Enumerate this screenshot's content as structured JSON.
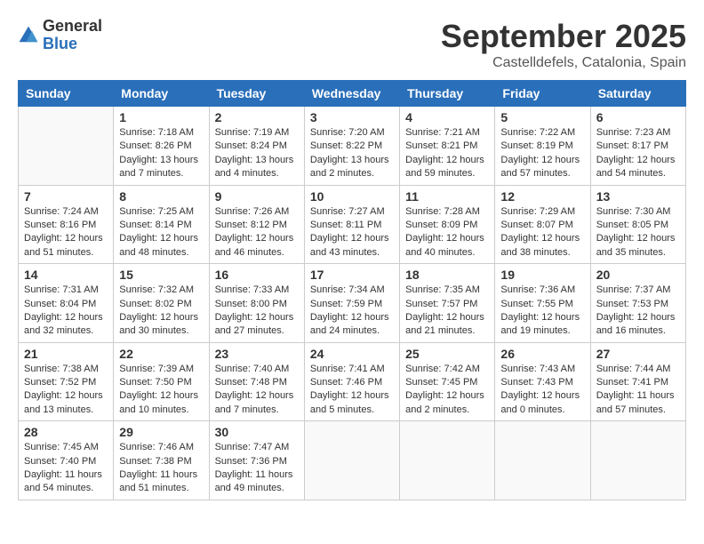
{
  "logo": {
    "general": "General",
    "blue": "Blue"
  },
  "header": {
    "month": "September 2025",
    "location": "Castelldefels, Catalonia, Spain"
  },
  "weekdays": [
    "Sunday",
    "Monday",
    "Tuesday",
    "Wednesday",
    "Thursday",
    "Friday",
    "Saturday"
  ],
  "weeks": [
    [
      {
        "day": "",
        "sunrise": "",
        "sunset": "",
        "daylight": ""
      },
      {
        "day": "1",
        "sunrise": "Sunrise: 7:18 AM",
        "sunset": "Sunset: 8:26 PM",
        "daylight": "Daylight: 13 hours and 7 minutes."
      },
      {
        "day": "2",
        "sunrise": "Sunrise: 7:19 AM",
        "sunset": "Sunset: 8:24 PM",
        "daylight": "Daylight: 13 hours and 4 minutes."
      },
      {
        "day": "3",
        "sunrise": "Sunrise: 7:20 AM",
        "sunset": "Sunset: 8:22 PM",
        "daylight": "Daylight: 13 hours and 2 minutes."
      },
      {
        "day": "4",
        "sunrise": "Sunrise: 7:21 AM",
        "sunset": "Sunset: 8:21 PM",
        "daylight": "Daylight: 12 hours and 59 minutes."
      },
      {
        "day": "5",
        "sunrise": "Sunrise: 7:22 AM",
        "sunset": "Sunset: 8:19 PM",
        "daylight": "Daylight: 12 hours and 57 minutes."
      },
      {
        "day": "6",
        "sunrise": "Sunrise: 7:23 AM",
        "sunset": "Sunset: 8:17 PM",
        "daylight": "Daylight: 12 hours and 54 minutes."
      }
    ],
    [
      {
        "day": "7",
        "sunrise": "Sunrise: 7:24 AM",
        "sunset": "Sunset: 8:16 PM",
        "daylight": "Daylight: 12 hours and 51 minutes."
      },
      {
        "day": "8",
        "sunrise": "Sunrise: 7:25 AM",
        "sunset": "Sunset: 8:14 PM",
        "daylight": "Daylight: 12 hours and 48 minutes."
      },
      {
        "day": "9",
        "sunrise": "Sunrise: 7:26 AM",
        "sunset": "Sunset: 8:12 PM",
        "daylight": "Daylight: 12 hours and 46 minutes."
      },
      {
        "day": "10",
        "sunrise": "Sunrise: 7:27 AM",
        "sunset": "Sunset: 8:11 PM",
        "daylight": "Daylight: 12 hours and 43 minutes."
      },
      {
        "day": "11",
        "sunrise": "Sunrise: 7:28 AM",
        "sunset": "Sunset: 8:09 PM",
        "daylight": "Daylight: 12 hours and 40 minutes."
      },
      {
        "day": "12",
        "sunrise": "Sunrise: 7:29 AM",
        "sunset": "Sunset: 8:07 PM",
        "daylight": "Daylight: 12 hours and 38 minutes."
      },
      {
        "day": "13",
        "sunrise": "Sunrise: 7:30 AM",
        "sunset": "Sunset: 8:05 PM",
        "daylight": "Daylight: 12 hours and 35 minutes."
      }
    ],
    [
      {
        "day": "14",
        "sunrise": "Sunrise: 7:31 AM",
        "sunset": "Sunset: 8:04 PM",
        "daylight": "Daylight: 12 hours and 32 minutes."
      },
      {
        "day": "15",
        "sunrise": "Sunrise: 7:32 AM",
        "sunset": "Sunset: 8:02 PM",
        "daylight": "Daylight: 12 hours and 30 minutes."
      },
      {
        "day": "16",
        "sunrise": "Sunrise: 7:33 AM",
        "sunset": "Sunset: 8:00 PM",
        "daylight": "Daylight: 12 hours and 27 minutes."
      },
      {
        "day": "17",
        "sunrise": "Sunrise: 7:34 AM",
        "sunset": "Sunset: 7:59 PM",
        "daylight": "Daylight: 12 hours and 24 minutes."
      },
      {
        "day": "18",
        "sunrise": "Sunrise: 7:35 AM",
        "sunset": "Sunset: 7:57 PM",
        "daylight": "Daylight: 12 hours and 21 minutes."
      },
      {
        "day": "19",
        "sunrise": "Sunrise: 7:36 AM",
        "sunset": "Sunset: 7:55 PM",
        "daylight": "Daylight: 12 hours and 19 minutes."
      },
      {
        "day": "20",
        "sunrise": "Sunrise: 7:37 AM",
        "sunset": "Sunset: 7:53 PM",
        "daylight": "Daylight: 12 hours and 16 minutes."
      }
    ],
    [
      {
        "day": "21",
        "sunrise": "Sunrise: 7:38 AM",
        "sunset": "Sunset: 7:52 PM",
        "daylight": "Daylight: 12 hours and 13 minutes."
      },
      {
        "day": "22",
        "sunrise": "Sunrise: 7:39 AM",
        "sunset": "Sunset: 7:50 PM",
        "daylight": "Daylight: 12 hours and 10 minutes."
      },
      {
        "day": "23",
        "sunrise": "Sunrise: 7:40 AM",
        "sunset": "Sunset: 7:48 PM",
        "daylight": "Daylight: 12 hours and 7 minutes."
      },
      {
        "day": "24",
        "sunrise": "Sunrise: 7:41 AM",
        "sunset": "Sunset: 7:46 PM",
        "daylight": "Daylight: 12 hours and 5 minutes."
      },
      {
        "day": "25",
        "sunrise": "Sunrise: 7:42 AM",
        "sunset": "Sunset: 7:45 PM",
        "daylight": "Daylight: 12 hours and 2 minutes."
      },
      {
        "day": "26",
        "sunrise": "Sunrise: 7:43 AM",
        "sunset": "Sunset: 7:43 PM",
        "daylight": "Daylight: 12 hours and 0 minutes."
      },
      {
        "day": "27",
        "sunrise": "Sunrise: 7:44 AM",
        "sunset": "Sunset: 7:41 PM",
        "daylight": "Daylight: 11 hours and 57 minutes."
      }
    ],
    [
      {
        "day": "28",
        "sunrise": "Sunrise: 7:45 AM",
        "sunset": "Sunset: 7:40 PM",
        "daylight": "Daylight: 11 hours and 54 minutes."
      },
      {
        "day": "29",
        "sunrise": "Sunrise: 7:46 AM",
        "sunset": "Sunset: 7:38 PM",
        "daylight": "Daylight: 11 hours and 51 minutes."
      },
      {
        "day": "30",
        "sunrise": "Sunrise: 7:47 AM",
        "sunset": "Sunset: 7:36 PM",
        "daylight": "Daylight: 11 hours and 49 minutes."
      },
      {
        "day": "",
        "sunrise": "",
        "sunset": "",
        "daylight": ""
      },
      {
        "day": "",
        "sunrise": "",
        "sunset": "",
        "daylight": ""
      },
      {
        "day": "",
        "sunrise": "",
        "sunset": "",
        "daylight": ""
      },
      {
        "day": "",
        "sunrise": "",
        "sunset": "",
        "daylight": ""
      }
    ]
  ]
}
